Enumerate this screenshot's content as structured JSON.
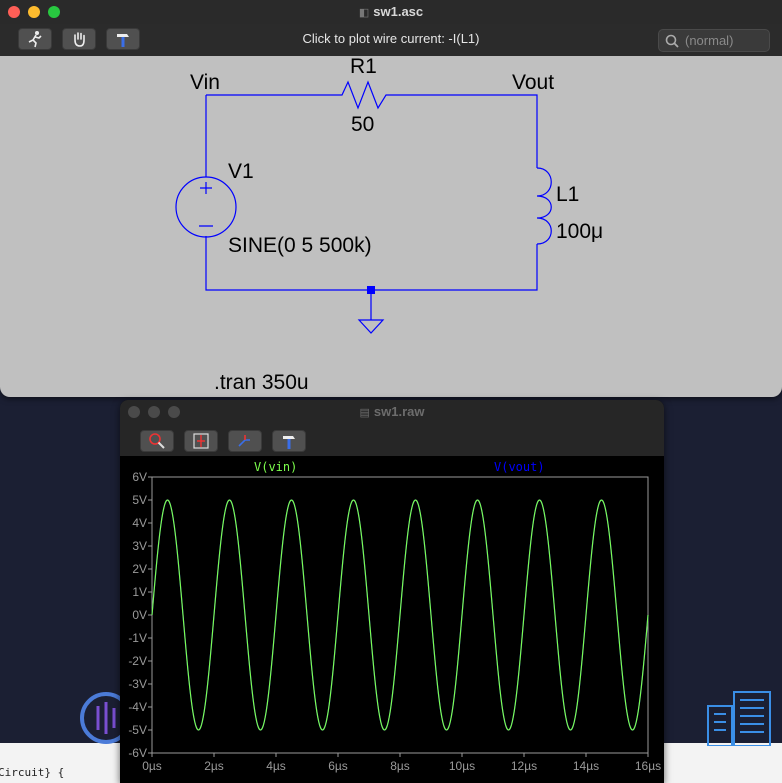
{
  "background": {
    "code_snippet": "Circuit} {"
  },
  "schematic_window": {
    "title": "sw1.asc",
    "hint": "Click to plot wire current: -I(L1)",
    "search_placeholder": "(normal)",
    "tools": [
      "run-icon",
      "hand-icon",
      "hammer-icon"
    ],
    "labels": {
      "vin": "Vin",
      "vout": "Vout",
      "r1_name": "R1",
      "r1_value": "50",
      "v1_name": "V1",
      "v1_value": "SINE(0 5 500k)",
      "l1_name": "L1",
      "l1_value": "100μ",
      "directive": ".tran 350u"
    },
    "colors": {
      "wire": "#0000ff",
      "background": "#c0c0c0"
    }
  },
  "waveform_window": {
    "title": "sw1.raw",
    "tools": [
      "zoom-icon",
      "autorange-icon",
      "pick-trace-icon",
      "hammer-icon"
    ]
  },
  "chart_data": {
    "type": "line",
    "series": [
      {
        "name": "V(vin)",
        "color": "#7cff4c",
        "amplitude": 5,
        "frequency_hz": 500000,
        "phase_deg": 0
      },
      {
        "name": "V(vout)",
        "color": "#0000ff",
        "amplitude": 5,
        "frequency_hz": 500000,
        "phase_deg": 0
      }
    ],
    "x_ticks": [
      "0µs",
      "2µs",
      "4µs",
      "6µs",
      "8µs",
      "10µs",
      "12µs",
      "14µs",
      "16µs"
    ],
    "y_ticks": [
      "6V",
      "5V",
      "4V",
      "3V",
      "2V",
      "1V",
      "0V",
      "-1V",
      "-2V",
      "-3V",
      "-4V",
      "-5V",
      "-6V"
    ],
    "xlim_us": [
      0,
      16
    ],
    "ylim": [
      -6,
      6
    ],
    "grid": false
  }
}
